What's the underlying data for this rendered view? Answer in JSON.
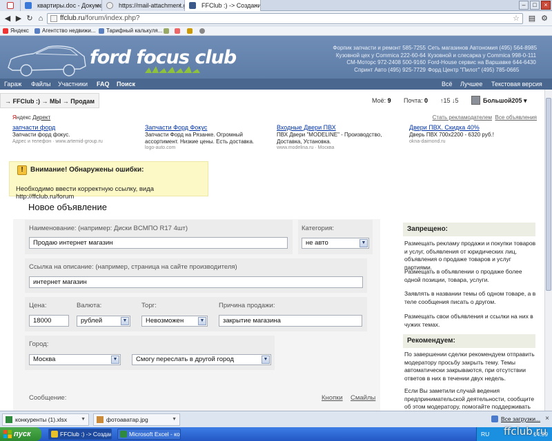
{
  "browser": {
    "tabs": [
      {
        "label": ""
      },
      {
        "label": "квартиры.doc - Документы"
      },
      {
        "label": "https://mail-attachment.googl"
      },
      {
        "label": "FFClub :) -> Создание новой"
      }
    ],
    "url_host": "ffclub.ru",
    "url_path": "/forum/index.php?",
    "bookmarks": [
      "Яндекс",
      "Агентство недвижи...",
      "Тарифный калькуля..."
    ]
  },
  "header": {
    "logo_text": "ford focus club",
    "ads_left": [
      "Форпик запчасти и ремонт 585-7255",
      "Кузовной цех у Commica 222-60-64",
      "СМ-Моторс 972-2408 500-9160",
      "Спринт Авто (495) 925-7729"
    ],
    "ads_right": [
      "Сеть магазинов Автономия (495) 564-8985",
      "Кузовной и слесарка у Commica 998-0-111",
      "Ford-House сервис на Варшавке 644-6430",
      "Форд Центр \"Пилот\" (495) 785-0665"
    ]
  },
  "menu": {
    "left": [
      "Гараж",
      "Файлы",
      "Участники",
      "FAQ",
      "Поиск"
    ],
    "right": [
      "Всё",
      "Лучшее",
      "Текстовая версия"
    ]
  },
  "crumbs": {
    "path": "→ FFClub :) → МЫ → Продам",
    "mine_label": "Моё:",
    "mine_value": "9",
    "mail_label": "Почта:",
    "mail_value": "0",
    "votes": "↑15 ↓5",
    "user": "Большой205 ▾"
  },
  "yandex": {
    "brand_y": "Я",
    "brand_rest": "ндекс",
    "direct": "Директ",
    "link_become": "Стать рекламодателем",
    "link_all": "Все объявления",
    "ads": [
      {
        "title": "запчасти форд",
        "desc": "Запчасти форд фокус.",
        "url": "Адрес и телефон · www.artemid-group.ru"
      },
      {
        "title": "Запчасти Форд Фокус",
        "desc": "Запчасти Форд на Рязанке. Огромный ассортимент. Низкие цены. Есть доставка.",
        "url": "logo-auto.com"
      },
      {
        "title": "Входные Двери ПВХ",
        "desc": "ПВХ Двери \"MODELINE\" - Производство, Доставка, Установка.",
        "url": "www.modelina.ru · Москва"
      },
      {
        "title": "Двери ПВХ. Скидка 40%",
        "desc": "Дверь ПВХ 700x2200 - 6320 руб.!",
        "url": "okna-daimond.ru"
      }
    ]
  },
  "warning": {
    "title": "Внимание! Обнаружены ошибки:",
    "message": "Необходимо ввести корректную ссылку, вида http://ffclub.ru/forum"
  },
  "form": {
    "title": "Новое объявление",
    "name_label": "Наименование: (например: Диски BCMПО R17 4шт)",
    "name_value": "Продаю интернет магазин",
    "category_label": "Категория:",
    "category_value": "не авто",
    "link_label": "Ссылка на описание: (например, страница на сайте производителя)",
    "link_value": "интернет магазин",
    "price_label": "Цена:",
    "price_value": "18000",
    "currency_label": "Валюта:",
    "currency_value": "рублей",
    "bargain_label": "Торг:",
    "bargain_value": "Невозможен",
    "reason_label": "Причина продажи:",
    "reason_value": "закрытие магазина",
    "city_label": "Город:",
    "city_value": "Москва",
    "ship_value": "Смогу переслать в другой город",
    "message_label": "Сообщение:",
    "buttons_link": "Кнопки",
    "smileys_link": "Смайлы"
  },
  "sidebar": {
    "forbidden_title": "Запрещено:",
    "forbidden": [
      "Размещать рекламу продажи и покупки товаров и услуг, объявления от юридических лиц, объявления о продаже товаров и услуг партиями.",
      "Размещать в объявлении о продаже более одной позиции, товара, услуги.",
      "Заявлять в названии темы об одном товаре, а в теле сообщения писать о другом.",
      "Размещать свои объявления и ссылки на них в чужих темах."
    ],
    "recommend_title": "Рекомендуем:",
    "recommend": [
      "По завершении сделки рекомендуем отправить модератору просьбу закрыть тему. Темы автоматически закрываются, при отсутствии ответов в них в течении двух недель.",
      "Если Вы заметили случай ведения предпринимательской деятельности, сообщите об этом модератору, помогайте поддерживать"
    ]
  },
  "downloads": {
    "items": [
      "конкуренты (1).xlsx",
      "фотоаватар.jpg"
    ],
    "all_label": "Все загрузки..."
  },
  "taskbar": {
    "start": "пуск",
    "apps": [
      "FFClub :) -> Создан...",
      "Microsoft Excel - кон..."
    ],
    "lang": "RU",
    "clock": "14:39"
  },
  "watermark": "ffclub.ru"
}
